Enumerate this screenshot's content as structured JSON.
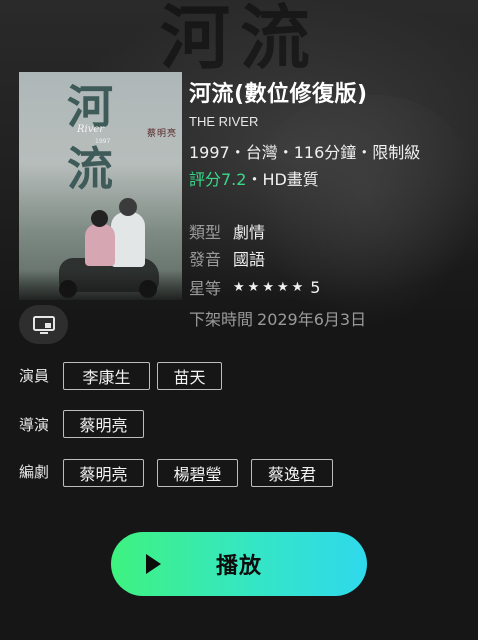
{
  "movie": {
    "title": "河流(數位修復版)",
    "english_title": "THE RIVER",
    "meta": "1997・台灣・116分鐘・限制級",
    "score": "評分7.2",
    "quality": "・HD畫質"
  },
  "poster": {
    "title_char_1": "河",
    "title_char_2": "流",
    "english": "River",
    "year": "1997",
    "director": "蔡明亮"
  },
  "details": {
    "genre_label": "類型",
    "genre_value": "劇情",
    "audio_label": "發音",
    "audio_value": "國語",
    "stars_label": "星等",
    "stars_filled": 5,
    "stars_value": "5",
    "expire_label": "下架時間",
    "expire_value": "2029年6月3日"
  },
  "credits": {
    "cast_label": "演員",
    "cast": [
      "李康生",
      "苗天"
    ],
    "director_label": "導演",
    "directors": [
      "蔡明亮"
    ],
    "writer_label": "編劇",
    "writers": [
      "蔡明亮",
      "楊碧瑩",
      "蔡逸君"
    ]
  },
  "actions": {
    "play_label": "播放",
    "cast_icon": "screen-cast-icon"
  },
  "colors": {
    "score": "#39d98a",
    "play_gradient_start": "#3ff27f",
    "play_gradient_end": "#2fd9ec"
  }
}
